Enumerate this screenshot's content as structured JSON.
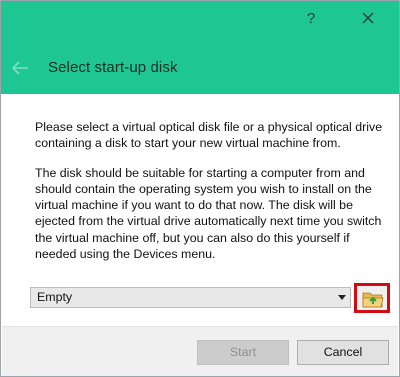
{
  "window": {
    "help_label": "?",
    "title": "Select start-up disk",
    "header_color": "#1ec792",
    "close_icon": "close-icon",
    "back_icon": "back-arrow-icon"
  },
  "content": {
    "paragraph1": "Please select a virtual optical disk file or a physical optical drive containing a disk to start your new virtual machine from.",
    "paragraph2": "The disk should be suitable for starting a computer from and should contain the operating system you wish to install on the virtual machine if you want to do that now. The disk will be ejected from the virtual drive automatically next time you switch the virtual machine off, but you can also do this yourself if needed using the Devices menu."
  },
  "disk_selector": {
    "selected": "Empty",
    "dropdown_icon": "chevron-down-icon",
    "browse_icon": "folder-open-icon",
    "highlight_color": "#d10b12"
  },
  "footer": {
    "start_label": "Start",
    "cancel_label": "Cancel"
  }
}
